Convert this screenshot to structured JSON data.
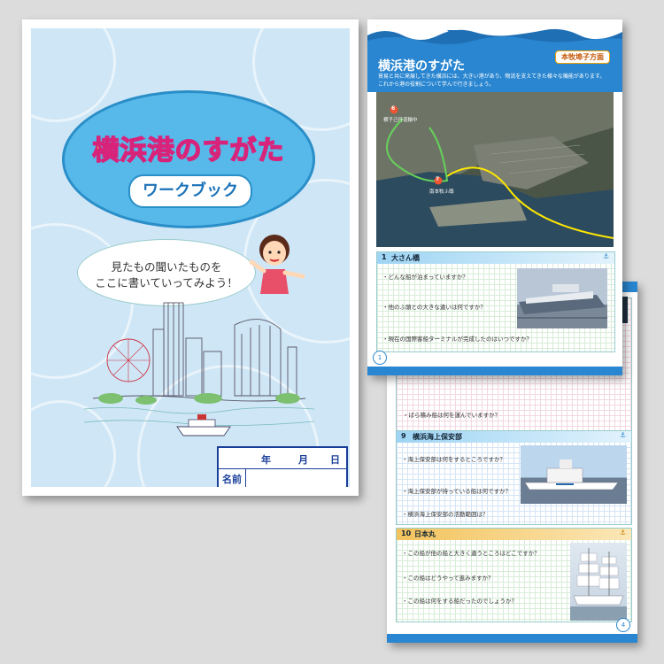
{
  "cover": {
    "title": "横浜港のすがた",
    "subtitle": "ワークブック",
    "bubble_line1": "見たもの聞いたものを",
    "bubble_line2": "ここに書いていってみよう！",
    "form_year": "年",
    "form_month": "月",
    "form_day": "日",
    "form_name_label": "名前"
  },
  "page1": {
    "title": "横浜港のすがた",
    "area_tag": "本牧埠子方面",
    "description": "貿易と共に発展してきた横浜には、大きい港があり、物流を支えてきた様々な機能があります。これから港の役割について学んで行きましょう。",
    "map_label_6": "6",
    "map_label_6_text": "横子己丹道輪中",
    "map_label_7": "7",
    "map_label_7_text": "南本牧ふ頭",
    "section_number": "1",
    "section_title": "大さん橋",
    "questions": [
      "・どんな船が泊まっていますか？",
      "・他のふ頭との大きな違いは何ですか？",
      "・現在の国際客船ターミナルが完成したのはいつですか？"
    ],
    "page_number": "1"
  },
  "page2": {
    "top_question": "・ばら積み船は何を運んでいますか？",
    "section9_number": "9",
    "section9_title": "横浜海上保安部",
    "section9_questions": [
      "・海上保安部は何をするところですか？",
      "・海上保安部が持っている船は何ですか？",
      "・横浜海上保安部の活動範囲は？"
    ],
    "section10_number": "10",
    "section10_title": "日本丸",
    "section10_questions": [
      "・この船が他の船と大きく違うところはどこですか？",
      "・この船はどうやって進みますか？",
      "・この船は何をする船だったのでしょうか？"
    ],
    "page_number": "4"
  },
  "colors": {
    "cover_bg": "#cfe6f6",
    "title_ellipse": "#57b9e9",
    "title_fill": "#ffe100",
    "title_stroke": "#d8237b",
    "accent_blue": "#2a86d0",
    "form_border": "#1a3f9a"
  }
}
